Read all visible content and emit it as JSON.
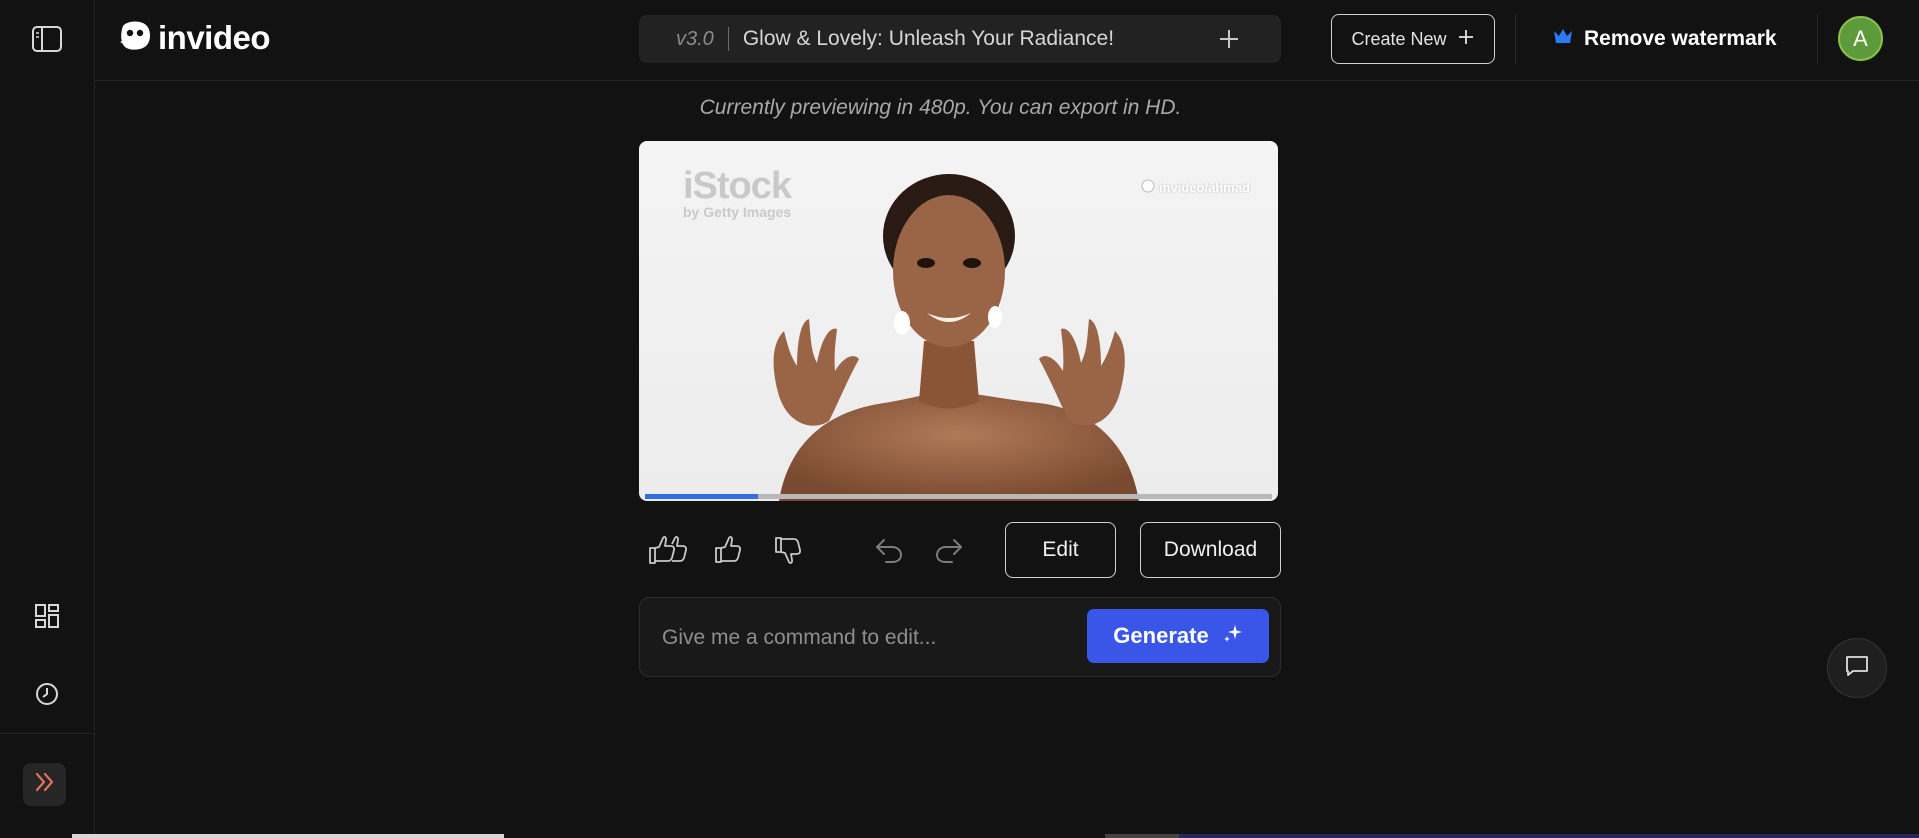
{
  "header": {
    "logo_text": "invideo",
    "version": "v3.0",
    "project_title": "Glow & Lovely: Unleash Your Radiance!",
    "create_new_label": "Create New",
    "remove_watermark_label": "Remove watermark",
    "avatar_initial": "A"
  },
  "sidebar": {
    "icons": [
      "sidebar-toggle-icon",
      "grid-icon",
      "clock-icon",
      "chevrons-right-icon"
    ]
  },
  "preview": {
    "note": "Currently previewing in 480p. You can export in HD.",
    "stock_brand": "iStock",
    "stock_sub": "by Getty Images",
    "watermark_handle": "invideo/ahmad",
    "progress_fraction": 0.18
  },
  "actions": {
    "edit_label": "Edit",
    "download_label": "Download"
  },
  "command": {
    "placeholder": "Give me a command to edit...",
    "generate_label": "Generate"
  },
  "colors": {
    "accent": "#3a56e8",
    "progress": "#2d6fe0",
    "crown": "#2b7bff",
    "avatar": "#5c9a3b",
    "expand_icon": "#e0735a"
  }
}
